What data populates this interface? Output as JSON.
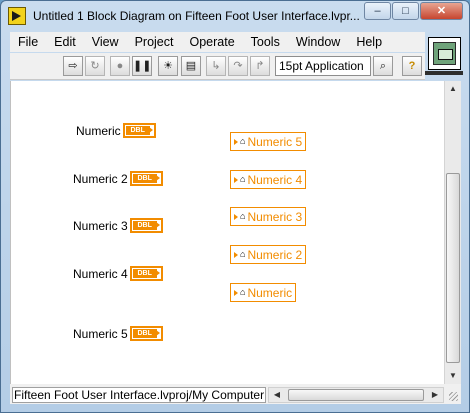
{
  "window": {
    "title": "Untitled 1 Block Diagram on Fifteen Foot User Interface.lvpr...",
    "buttons": {
      "minimize": "–",
      "maximize": "□",
      "close": "✕"
    }
  },
  "menu": [
    "File",
    "Edit",
    "View",
    "Project",
    "Operate",
    "Tools",
    "Window",
    "Help"
  ],
  "toolbar": {
    "font_select": "15pt Application",
    "icons": [
      "run-arrow-icon",
      "run-continuously-icon",
      "abort-icon",
      "pause-icon",
      "highlight-execution-icon",
      "retain-wire-values-icon",
      "step-into-icon",
      "step-over-icon",
      "step-out-icon",
      "search-icon",
      "help-icon"
    ]
  },
  "controls": [
    {
      "label": "Numeric",
      "type_badge": "DBL"
    },
    {
      "label": "Numeric 2",
      "type_badge": "DBL"
    },
    {
      "label": "Numeric 3",
      "type_badge": "DBL"
    },
    {
      "label": "Numeric 4",
      "type_badge": "DBL"
    },
    {
      "label": "Numeric 5",
      "type_badge": "DBL"
    }
  ],
  "indicators": [
    {
      "label": "Numeric 5"
    },
    {
      "label": "Numeric 4"
    },
    {
      "label": "Numeric 3"
    },
    {
      "label": "Numeric 2"
    },
    {
      "label": "Numeric"
    }
  ],
  "status": {
    "path": "Fifteen Foot User Interface.lvproj/My Computer"
  },
  "colors": {
    "accent": "#f28c00",
    "canvas": "#ffffff",
    "chrome": "#f0f0f0"
  }
}
